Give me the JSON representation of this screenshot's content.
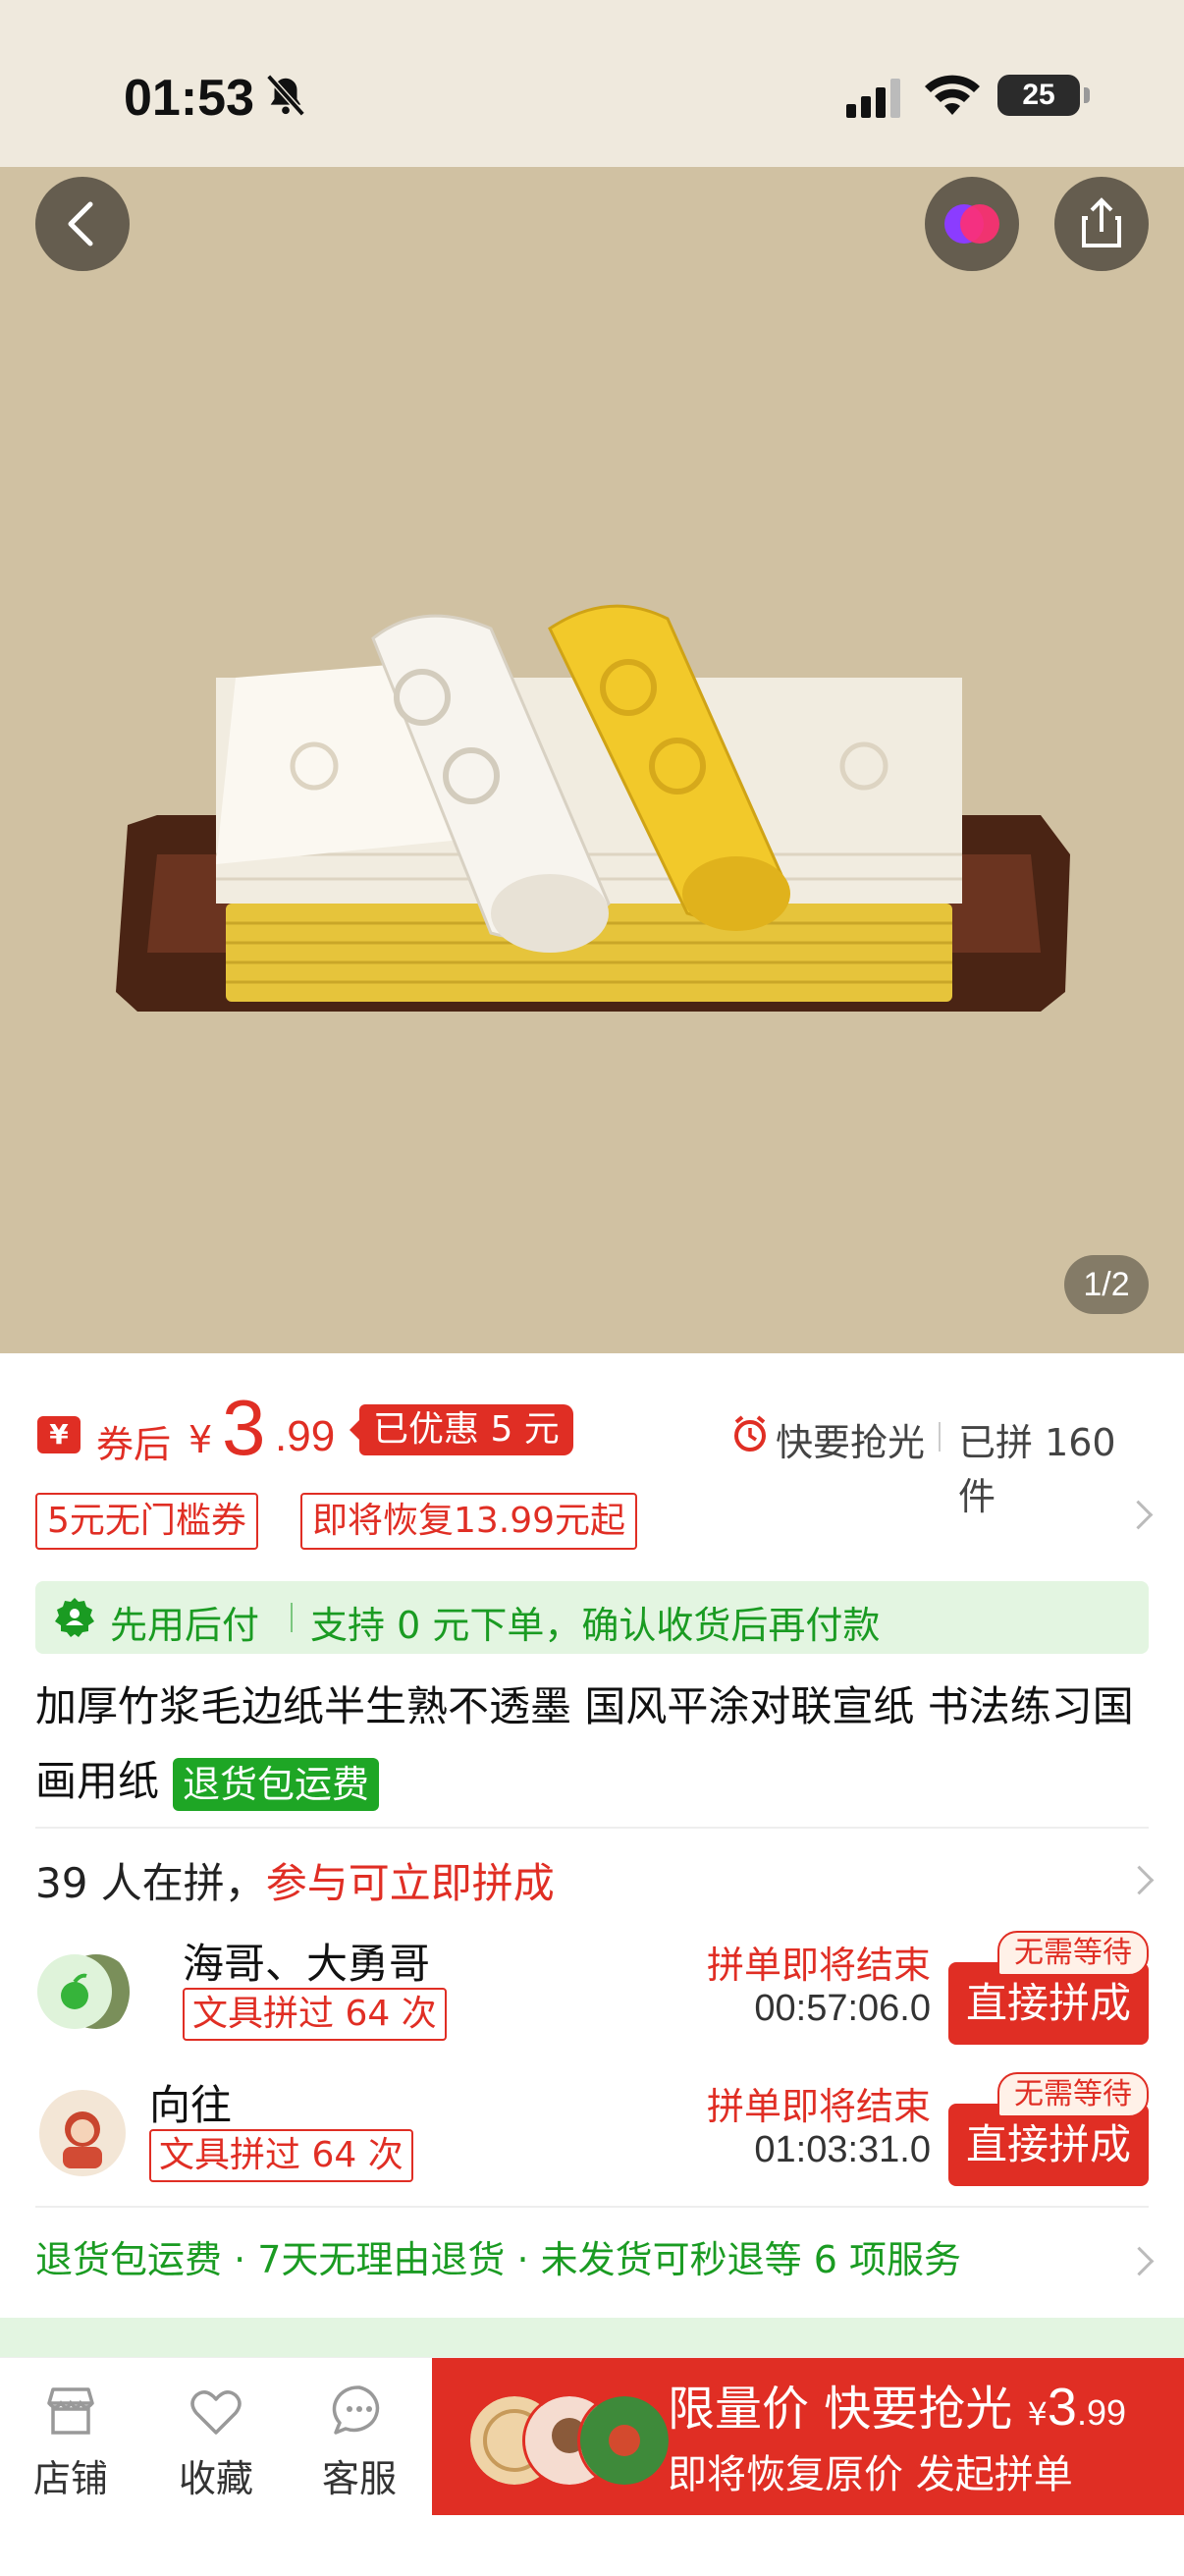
{
  "status": {
    "time": "01:53",
    "battery": "25"
  },
  "hero": {
    "counter": "1/2"
  },
  "price": {
    "coupon_icon": "¥",
    "after_label": "券后",
    "symbol": "¥",
    "int": "3",
    "dec": ".99",
    "discount": "已优惠 5 元",
    "hurry": "快要抢光",
    "sold": "已拼 160 件"
  },
  "coupons": {
    "tag1": "5元无门槛券",
    "tag2": "即将恢复13.99元起"
  },
  "pay_later": {
    "title": "先用后付",
    "text": "支持 0 元下单，确认收货后再付款"
  },
  "product": {
    "title": "加厚竹浆毛边纸半生熟不透墨 国风平涂对联宣纸 书法练习国画用纸",
    "badge": "退货包运费"
  },
  "group": {
    "count_text": "39 人在拼，",
    "cta_text": "参与可立即拼成",
    "rows": [
      {
        "name": "海哥、大勇哥",
        "tag": "文具拼过 64 次",
        "ending": "拼单即将结束",
        "timer": "00:57:06.0",
        "button": "直接拼成",
        "badge": "无需等待"
      },
      {
        "name": "向往",
        "tag": "文具拼过 64 次",
        "ending": "拼单即将结束",
        "timer": "01:03:31.0",
        "button": "直接拼成",
        "badge": "无需等待"
      }
    ]
  },
  "services": "退货包运费 · 7天无理由退货 · 未发货可秒退等 6 项服务",
  "bottom": {
    "store": "店铺",
    "favorite": "收藏",
    "service": "客服",
    "buy_line1": "限量价 快要抢光",
    "buy_price_symbol": "¥",
    "buy_price_int": "3",
    "buy_price_dec": ".99",
    "buy_line2": "即将恢复原价 发起拼单"
  },
  "colors": {
    "accent": "#e02e24",
    "green": "#1a9b22",
    "hero_bg": "#d0c1a2"
  }
}
